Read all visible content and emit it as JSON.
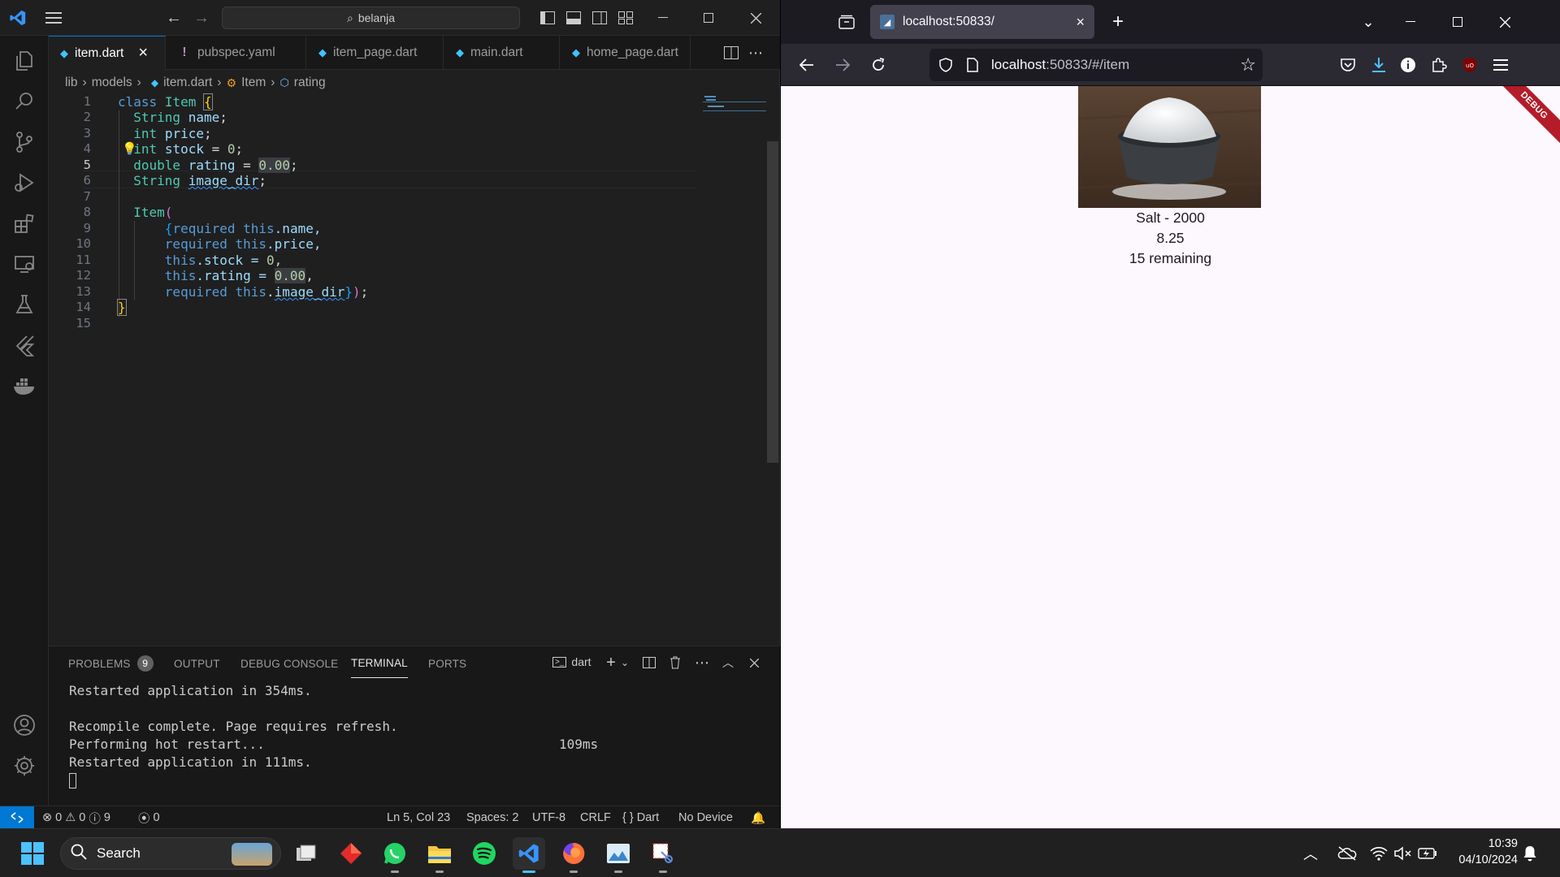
{
  "vscode": {
    "search": "belanja",
    "tabs": [
      {
        "label": "item.dart",
        "close": "×"
      },
      {
        "label": "pubspec.yaml",
        "glyph": "!"
      },
      {
        "label": "item_page.dart"
      },
      {
        "label": "main.dart"
      },
      {
        "label": "home_page.dart"
      }
    ],
    "breadcrumb": [
      "lib",
      "models",
      "item.dart",
      "Item",
      "rating"
    ],
    "line_numbers": [
      "1",
      "2",
      "3",
      "4",
      "5",
      "6",
      "7",
      "8",
      "9",
      "10",
      "11",
      "12",
      "13",
      "14",
      "15"
    ],
    "code": {
      "l1": [
        "class",
        "Item",
        "{"
      ],
      "l2": [
        "String",
        "name",
        ";"
      ],
      "l3": [
        "int",
        "price",
        ";"
      ],
      "l4": [
        "int",
        "stock",
        "=",
        "0",
        ";"
      ],
      "l5": [
        "double",
        "rating",
        "=",
        "0.00",
        ";"
      ],
      "l6": [
        "String",
        "image_dir",
        ";"
      ],
      "l8": [
        "Item",
        "("
      ],
      "l9": [
        "{",
        "required",
        "this",
        ".name,"
      ],
      "l10": [
        "required",
        "this",
        ".price,"
      ],
      "l11": [
        "this",
        ".stock = ",
        "0",
        ","
      ],
      "l12": [
        "this",
        ".rating = ",
        "0.00",
        ","
      ],
      "l13": [
        "required",
        "this",
        ".",
        "image_dir",
        "}",
        ")",
        ";"
      ],
      "l14": [
        "}"
      ]
    },
    "panel_tabs": [
      "PROBLEMS",
      "OUTPUT",
      "DEBUG CONSOLE",
      "TERMINAL",
      "PORTS"
    ],
    "problems_count": "9",
    "terminal_name": "dart",
    "terminal_lines": [
      "Restarted application in 354ms.",
      "",
      "Recompile complete. Page requires refresh.",
      "Performing hot restart...",
      "Restarted application in 111ms."
    ],
    "terminal_timing": "109ms",
    "status": {
      "errors": "0",
      "warnings": "0",
      "infos": "9",
      "ports": "0",
      "position": "Ln 5, Col 23",
      "spaces": "Spaces: 2",
      "encoding": "UTF-8",
      "eol": "CRLF",
      "language": "Dart",
      "device": "No Device"
    }
  },
  "firefox": {
    "tab_title": "localhost:50833/",
    "url_host": "localhost",
    "url_rest": ":50833/#/item",
    "debug_banner": "DEBUG",
    "item": {
      "title": "Salt - 2000",
      "rating": "8.25",
      "stock": "15 remaining"
    }
  },
  "taskbar": {
    "search": "Search",
    "time": "10:39",
    "date": "04/10/2024"
  },
  "colors": {
    "vscode_accent": "#0078d4",
    "flutter_bg": "#fdf7fe",
    "debug_banner": "#b31c28"
  }
}
